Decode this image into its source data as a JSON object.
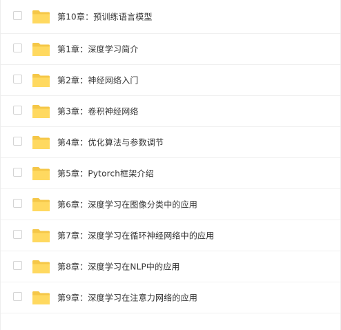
{
  "colors": {
    "folder_back": "#f5c748",
    "folder_front": "#ffd960",
    "text": "#333333",
    "divider": "#f0f0f0",
    "checkbox_border": "#d4d4d4"
  },
  "file_list": {
    "items": [
      {
        "icon": "folder-icon",
        "label": "第10章：预训练语言模型"
      },
      {
        "icon": "folder-icon",
        "label": "第1章：深度学习简介"
      },
      {
        "icon": "folder-icon",
        "label": "第2章：神经网络入门"
      },
      {
        "icon": "folder-icon",
        "label": "第3章：卷积神经网络"
      },
      {
        "icon": "folder-icon",
        "label": "第4章：优化算法与参数调节"
      },
      {
        "icon": "folder-icon",
        "label": "第5章：Pytorch框架介绍"
      },
      {
        "icon": "folder-icon",
        "label": "第6章：深度学习在图像分类中的应用"
      },
      {
        "icon": "folder-icon",
        "label": "第7章：深度学习在循环神经网络中的应用"
      },
      {
        "icon": "folder-icon",
        "label": "第8章：深度学习在NLP中的应用"
      },
      {
        "icon": "folder-icon",
        "label": "第9章：深度学习在注意力网络的应用"
      }
    ]
  }
}
